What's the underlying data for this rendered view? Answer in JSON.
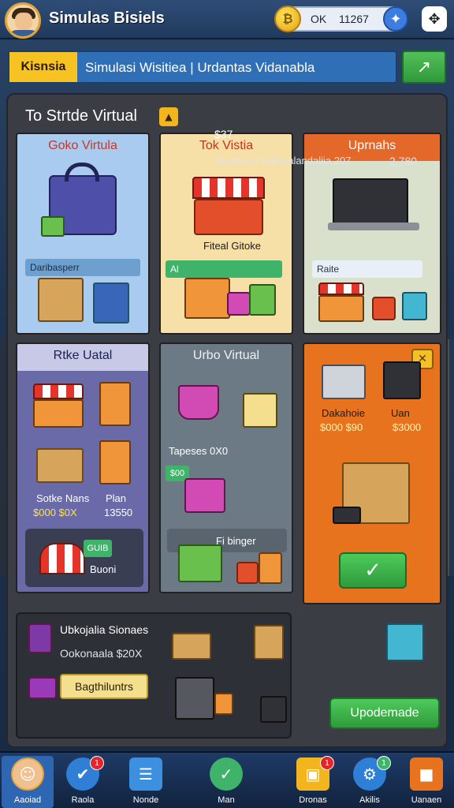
{
  "app": {
    "title": "Simulas Bisiels"
  },
  "currency": {
    "label": "OK",
    "value": "11267",
    "add_icon": "plus-icon"
  },
  "menu": {
    "icon": "menu-icon"
  },
  "secondary_bar": {
    "tag": "Kisnsia",
    "text": "Simulasi Wisitiea | Urdantas Vidanabla"
  },
  "panel": {
    "title": "To Strtde Virtual",
    "cards": [
      {
        "title": "Goko Virtula",
        "strip": "Daribasperr"
      },
      {
        "title": "Tok Vistia",
        "subtitle": "Fiteal Gitoke",
        "strip": "Al"
      },
      {
        "title": "Uprnahs",
        "strip": "Raite"
      },
      {
        "title": "Rtke Uatal",
        "caption1": "Sotke Nans",
        "caption2": "Plan",
        "price1": "$000 $0X",
        "price2": "13550",
        "tag": "GUIB",
        "sub": "Buoni"
      },
      {
        "title": "Urbo Virtual",
        "caption": "Tapeses 0X0",
        "tag": "$00",
        "sub": "Fi binger"
      },
      {
        "caption1": "Dakahoie",
        "caption2": "Uan",
        "price1": "$000 $90",
        "price2": "$3000"
      }
    ]
  },
  "info": {
    "title": "Ubkojalia Sionaes",
    "subtitle": "Ookonaala $20X",
    "button": "Bagthiluntrs",
    "price1": "$37",
    "description": "Boarkoon Bakaralandaliia 207",
    "price2": "2,780"
  },
  "update_button": "Upodemade",
  "bottom_nav": [
    {
      "label": "Aaoiad",
      "icon": "avatar-icon",
      "active": true
    },
    {
      "label": "Raola",
      "icon": "chat-icon",
      "badge": "1"
    },
    {
      "label": "Nonde",
      "icon": "list-icon"
    },
    {
      "label": "Man",
      "icon": "check-icon"
    },
    {
      "label": "Dronas",
      "icon": "box-icon",
      "badge": "1"
    },
    {
      "label": "Akilis",
      "icon": "gear-icon",
      "badge": "1",
      "badge_color": "green"
    },
    {
      "label": "Uanaen",
      "icon": "package-icon"
    }
  ],
  "colors": {
    "accent_green": "#3fb36a",
    "accent_orange": "#e8731e",
    "accent_yellow": "#f6c323",
    "accent_blue": "#2f6fb6"
  }
}
